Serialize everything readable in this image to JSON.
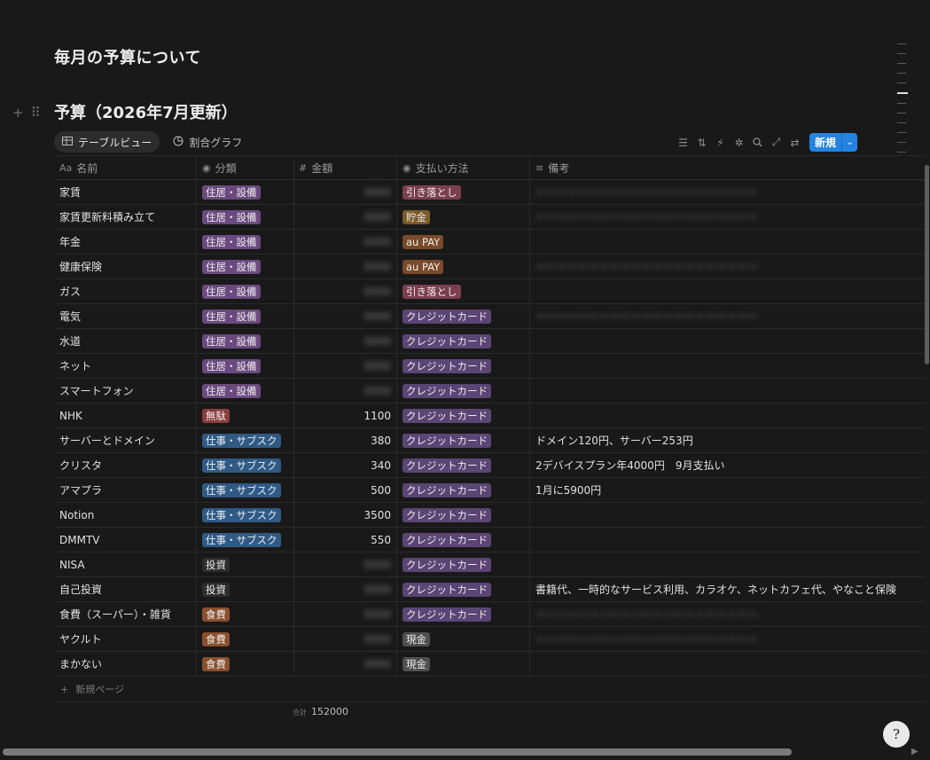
{
  "page": {
    "title": "毎月の予算について"
  },
  "database": {
    "title": "予算（2026年7月更新）",
    "views": [
      {
        "label": "テーブルビュー",
        "icon": "table-icon",
        "active": true
      },
      {
        "label": "割合グラフ",
        "icon": "pie-chart-icon",
        "active": false
      }
    ],
    "toolbar": {
      "icons": [
        "filter-icon",
        "sort-icon",
        "automation-icon",
        "format-icon",
        "search-icon",
        "expand-icon",
        "settings-icon"
      ],
      "new_label": "新規"
    },
    "columns": [
      {
        "label": "名前",
        "icon_glyph": "Aa"
      },
      {
        "label": "分類",
        "icon_glyph": "◉"
      },
      {
        "label": "金額",
        "icon_glyph": "#"
      },
      {
        "label": "支払い方法",
        "icon_glyph": "◉"
      },
      {
        "label": "備考",
        "icon_glyph": "≡"
      }
    ],
    "colors": {
      "住居・設備": "#6a4a7e",
      "無駄": "#8a3d3d",
      "仕事・サブスク": "#2f5a86",
      "投資": "#2d2d2d",
      "食費": "#8a4f2d",
      "引き落とし": "#7b3f4f",
      "貯金": "#7a5b2a",
      "au PAY": "#7a4a2a",
      "クレジットカード": "#5b4575",
      "現金": "#4f4f4f"
    },
    "rows": [
      {
        "name": "家賃",
        "category": "住居・設備",
        "amount": "",
        "payment": "引き落とし",
        "note": "",
        "hidden_amount": true,
        "hidden_note": true
      },
      {
        "name": "家賃更新料積み立て",
        "category": "住居・設備",
        "amount": "",
        "payment": "貯金",
        "note": "",
        "hidden_amount": true,
        "hidden_note": true
      },
      {
        "name": "年金",
        "category": "住居・設備",
        "amount": "",
        "payment": "au PAY",
        "note": "",
        "hidden_amount": true,
        "hidden_note": false
      },
      {
        "name": "健康保険",
        "category": "住居・設備",
        "amount": "",
        "payment": "au PAY",
        "note": "",
        "hidden_amount": true,
        "hidden_note": true
      },
      {
        "name": "ガス",
        "category": "住居・設備",
        "amount": "",
        "payment": "引き落とし",
        "note": "",
        "hidden_amount": true,
        "hidden_note": false
      },
      {
        "name": "電気",
        "category": "住居・設備",
        "amount": "",
        "payment": "クレジットカード",
        "note": "",
        "hidden_amount": true,
        "hidden_note": true
      },
      {
        "name": "水道",
        "category": "住居・設備",
        "amount": "",
        "payment": "クレジットカード",
        "note": "",
        "hidden_amount": true,
        "hidden_note": false
      },
      {
        "name": "ネット",
        "category": "住居・設備",
        "amount": "",
        "payment": "クレジットカード",
        "note": "",
        "hidden_amount": true,
        "hidden_note": false
      },
      {
        "name": "スマートフォン",
        "category": "住居・設備",
        "amount": "",
        "payment": "クレジットカード",
        "note": "",
        "hidden_amount": true,
        "hidden_note": false
      },
      {
        "name": "NHK",
        "category": "無駄",
        "amount": "1100",
        "payment": "クレジットカード",
        "note": "",
        "hidden_amount": false,
        "hidden_note": false
      },
      {
        "name": "サーバーとドメイン",
        "category": "仕事・サブスク",
        "amount": "380",
        "payment": "クレジットカード",
        "note": "ドメイン120円、サーバー253円",
        "hidden_amount": false,
        "hidden_note": false
      },
      {
        "name": "クリスタ",
        "category": "仕事・サブスク",
        "amount": "340",
        "payment": "クレジットカード",
        "note": "2デバイスプラン年4000円　9月支払い",
        "hidden_amount": false,
        "hidden_note": false
      },
      {
        "name": "アマプラ",
        "category": "仕事・サブスク",
        "amount": "500",
        "payment": "クレジットカード",
        "note": "1月に5900円",
        "hidden_amount": false,
        "hidden_note": false
      },
      {
        "name": "Notion",
        "category": "仕事・サブスク",
        "amount": "3500",
        "payment": "クレジットカード",
        "note": "",
        "hidden_amount": false,
        "hidden_note": false
      },
      {
        "name": "DMMTV",
        "category": "仕事・サブスク",
        "amount": "550",
        "payment": "クレジットカード",
        "note": "",
        "hidden_amount": false,
        "hidden_note": false
      },
      {
        "name": "NISA",
        "category": "投資",
        "amount": "",
        "payment": "クレジットカード",
        "note": "",
        "hidden_amount": true,
        "hidden_note": false
      },
      {
        "name": "自己投資",
        "category": "投資",
        "amount": "",
        "payment": "クレジットカード",
        "note": "書籍代、一時的なサービス利用、カラオケ、ネットカフェ代、やなこと保険",
        "hidden_amount": true,
        "hidden_note": false
      },
      {
        "name": "食費（スーパー）・雑貨",
        "category": "食費",
        "amount": "",
        "payment": "クレジットカード",
        "note": "",
        "hidden_amount": true,
        "hidden_note": true
      },
      {
        "name": "ヤクルト",
        "category": "食費",
        "amount": "",
        "payment": "現金",
        "note": "",
        "hidden_amount": true,
        "hidden_note": true
      },
      {
        "name": "まかない",
        "category": "食費",
        "amount": "",
        "payment": "現金",
        "note": "",
        "hidden_amount": true,
        "hidden_note": false
      }
    ],
    "new_page_label": "新規ページ",
    "summary": {
      "label": "合計",
      "value": "152000"
    }
  }
}
